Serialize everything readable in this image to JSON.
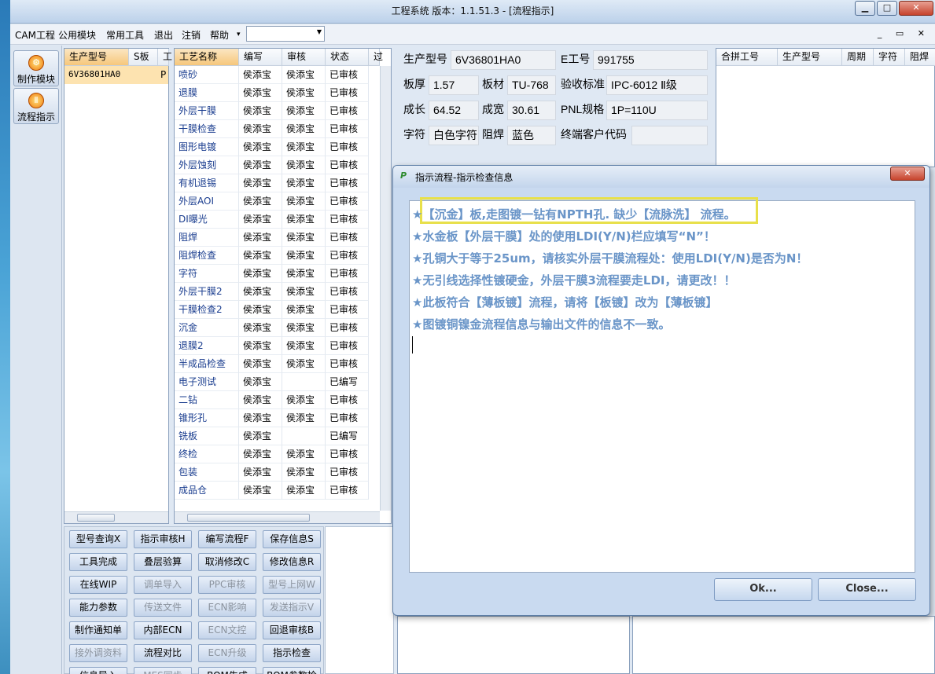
{
  "window": {
    "title": "工程系统   版本：1.1.51.3 - [流程指示]",
    "minimize": "▁",
    "maximize": "□",
    "close": "✕"
  },
  "menubar": {
    "items": [
      "CAM工程",
      "公用模块",
      "常用工具",
      "退出",
      "注销",
      "帮助"
    ],
    "combo_value": "",
    "mdi_controls": "_ ▭ ✕"
  },
  "left_nav": [
    {
      "label": "制作模块",
      "icon": "flame-icon",
      "glyph": "⚙"
    },
    {
      "label": "流程指示",
      "icon": "pause-icon",
      "glyph": "Ⅱ"
    }
  ],
  "model_list": {
    "headers": [
      "生产型号",
      "S板",
      "工"
    ],
    "rows": [
      {
        "model": "6V36801HA0",
        "s": "P"
      }
    ]
  },
  "process_table": {
    "headers": [
      "工艺名称",
      "编写",
      "审核",
      "状态",
      "过"
    ],
    "rows": [
      [
        "喷砂",
        "侯添宝",
        "侯添宝",
        "已审核"
      ],
      [
        "退膜",
        "侯添宝",
        "侯添宝",
        "已审核"
      ],
      [
        "外层干膜",
        "侯添宝",
        "侯添宝",
        "已审核"
      ],
      [
        "干膜检查",
        "侯添宝",
        "侯添宝",
        "已审核"
      ],
      [
        "图形电镀",
        "侯添宝",
        "侯添宝",
        "已审核"
      ],
      [
        "外层蚀刻",
        "侯添宝",
        "侯添宝",
        "已审核"
      ],
      [
        "有机退锡",
        "侯添宝",
        "侯添宝",
        "已审核"
      ],
      [
        "外层AOI",
        "侯添宝",
        "侯添宝",
        "已审核"
      ],
      [
        "DI曝光",
        "侯添宝",
        "侯添宝",
        "已审核"
      ],
      [
        "阻焊",
        "侯添宝",
        "侯添宝",
        "已审核"
      ],
      [
        "阻焊检查",
        "侯添宝",
        "侯添宝",
        "已审核"
      ],
      [
        "字符",
        "侯添宝",
        "侯添宝",
        "已审核"
      ],
      [
        "外层干膜2",
        "侯添宝",
        "侯添宝",
        "已审核"
      ],
      [
        "干膜检查2",
        "侯添宝",
        "侯添宝",
        "已审核"
      ],
      [
        "沉金",
        "侯添宝",
        "侯添宝",
        "已审核"
      ],
      [
        "退膜2",
        "侯添宝",
        "侯添宝",
        "已审核"
      ],
      [
        "半成品检查",
        "侯添宝",
        "侯添宝",
        "已审核"
      ],
      [
        "电子测试",
        "侯添宝",
        "",
        "已编写"
      ],
      [
        "二钻",
        "侯添宝",
        "侯添宝",
        "已审核"
      ],
      [
        "锥形孔",
        "侯添宝",
        "侯添宝",
        "已审核"
      ],
      [
        "铣板",
        "侯添宝",
        "",
        "已编写"
      ],
      [
        "终检",
        "侯添宝",
        "侯添宝",
        "已审核"
      ],
      [
        "包装",
        "侯添宝",
        "侯添宝",
        "已审核"
      ],
      [
        "成品仓",
        "侯添宝",
        "侯添宝",
        "已审核"
      ]
    ]
  },
  "info": {
    "model_label": "生产型号",
    "model_value": "6V36801HA0",
    "e_label": "E工号",
    "e_value": "991755",
    "thick_label": "板厚",
    "thick_value": "1.57",
    "mat_label": "板材",
    "mat_value": "TU-768",
    "std_label": "验收标准",
    "std_value": "IPC-6012 Ⅱ级",
    "len_label": "成长",
    "len_value": "64.52",
    "wid_label": "成宽",
    "wid_value": "30.61",
    "pnl_label": "PNL规格",
    "pnl_value": "1P=110U",
    "char_label": "字符",
    "char_value": "白色字符",
    "mask_label": "阻焊",
    "mask_value": "蓝色",
    "cust_label": "终端客户代码",
    "cust_value": ""
  },
  "merge_table": {
    "headers": [
      "合拼工号",
      "生产型号",
      "周期",
      "字符",
      "阻焊"
    ]
  },
  "buttons": [
    {
      "label": "型号查询X",
      "enabled": true
    },
    {
      "label": "指示审核H",
      "enabled": true
    },
    {
      "label": "编写流程F",
      "enabled": true
    },
    {
      "label": "保存信息S",
      "enabled": true
    },
    {
      "label": "工具完成",
      "enabled": true
    },
    {
      "label": "叠层验算",
      "enabled": true
    },
    {
      "label": "取消修改C",
      "enabled": true
    },
    {
      "label": "修改信息R",
      "enabled": true
    },
    {
      "label": "在线WIP",
      "enabled": true
    },
    {
      "label": "调单导入",
      "enabled": false
    },
    {
      "label": "PPC审核",
      "enabled": false
    },
    {
      "label": "型号上网W",
      "enabled": false
    },
    {
      "label": "能力参数",
      "enabled": true
    },
    {
      "label": "传送文件",
      "enabled": false
    },
    {
      "label": "ECN影响",
      "enabled": false
    },
    {
      "label": "发送指示V",
      "enabled": false
    },
    {
      "label": "制作通知单",
      "enabled": true
    },
    {
      "label": "内部ECN",
      "enabled": true
    },
    {
      "label": "ECN文控",
      "enabled": false
    },
    {
      "label": "回退审核B",
      "enabled": true
    },
    {
      "label": "接外调资料",
      "enabled": false
    },
    {
      "label": "流程对比",
      "enabled": true
    },
    {
      "label": "ECN升级",
      "enabled": false
    },
    {
      "label": "指示检查",
      "enabled": true
    },
    {
      "label": "信息导入",
      "enabled": true
    },
    {
      "label": "MES同步",
      "enabled": false
    },
    {
      "label": "BOM生成",
      "enabled": true
    },
    {
      "label": "BOM参数检查",
      "enabled": true
    }
  ],
  "dialog": {
    "title": "指示流程-指示检查信息",
    "close": "✕",
    "messages": [
      "★【沉金】板,走图镀一钻有NPTH孔. 缺少【流脉洗】 流程。",
      "★水金板【外层干膜】处的使用LDI(Y/N)栏应填写“N”！",
      "★孔铜大于等于25um，请核实外层干膜流程处：使用LDI(Y/N)是否为N！",
      "★无引线选择性镀硬金，外层干膜3流程要走LDI，请更改！！",
      "★此板符合【薄板镀】流程，请将【板镀】改为【薄板镀】",
      "★图镀铜镍金流程信息与输出文件的信息不一致。"
    ],
    "ok_label": "Ok...",
    "close_label": "Close..."
  },
  "colors": {
    "message_text": "#6a95c8",
    "highlight_box": "#e8e04a",
    "selected_row": "#fde3b0"
  }
}
